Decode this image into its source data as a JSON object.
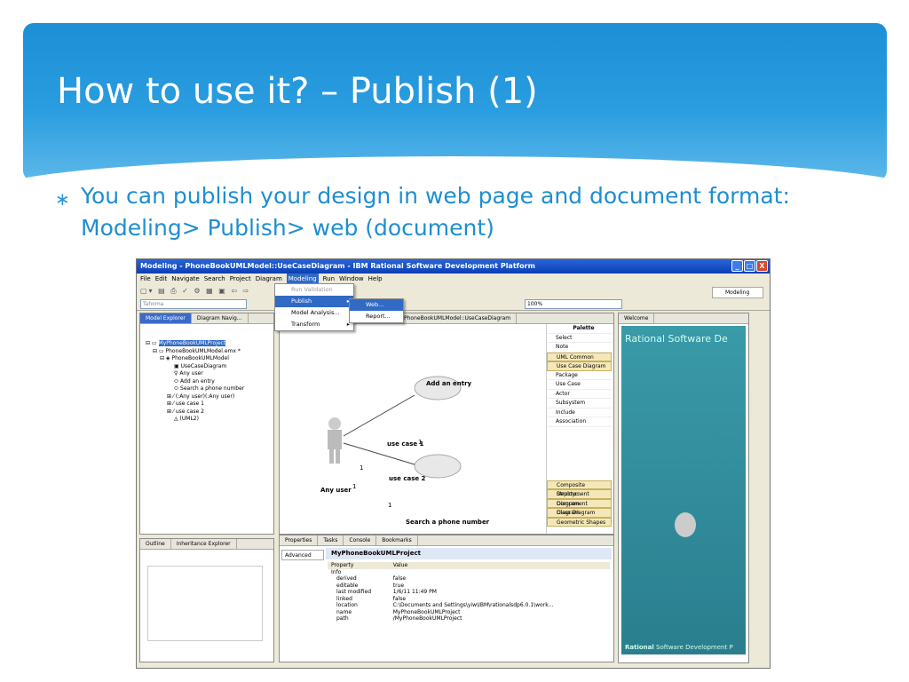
{
  "slide": {
    "title": "How to use it? – Publish (1)",
    "bullet": "You can publish your design in web page and document format: Modeling> Publish> web (document)",
    "bullet_marker": "∗"
  },
  "window": {
    "title": "Modeling - PhoneBookUMLModel::UseCaseDiagram - IBM Rational Software Development Platform",
    "buttons": [
      "_",
      "□",
      "X"
    ]
  },
  "menubar": [
    "File",
    "Edit",
    "Navigate",
    "Search",
    "Project",
    "Diagram",
    "Modeling",
    "Run",
    "Window",
    "Help"
  ],
  "toolbar": {
    "font": "Tahoma",
    "zoom": "100%",
    "perspective": "Modeling"
  },
  "modeling_menu": [
    {
      "label": "Run Validation",
      "disabled": true
    },
    {
      "label": "Publish",
      "submenu": true,
      "highlight": true
    },
    {
      "label": "Model Analysis..."
    },
    {
      "label": "Transform",
      "submenu": true
    }
  ],
  "publish_submenu": [
    "Web...",
    "Report..."
  ],
  "model_explorer": {
    "tabs": [
      "Model Explorer",
      "Diagram Navig..."
    ],
    "tree": [
      "MyPhoneBookUMLProject",
      "PhoneBookUMLModel.emx *",
      "PhoneBookUMLModel",
      "UseCaseDiagram",
      "Any user",
      "Add an entry",
      "Search a phone number",
      "(:Any user)(:Any user)",
      "use case 1",
      "use case 2",
      "(UML2)"
    ]
  },
  "editor": {
    "tab": "PhoneBookUMLModel::UseCaseDiagram",
    "actor": "Any user",
    "uc1": "Add an entry",
    "uc2": "Search a phone number",
    "assoc1": "use case 1",
    "assoc2": "use case 2",
    "m1": "1",
    "m2": "1",
    "m3": "1",
    "m4": "1"
  },
  "palette": {
    "title": "Palette",
    "tools": [
      "Select",
      "Note"
    ],
    "drawers": [
      "UML Common",
      "Use Case Diagram"
    ],
    "items": [
      "Package",
      "Use Case",
      "Actor",
      "Subsystem",
      "Include",
      "Association"
    ],
    "bottom_drawers": [
      "Composite Structu...",
      "Deployment Diagram",
      "Component Diagram",
      "Class Diagram",
      "Geometric Shapes"
    ]
  },
  "welcome": {
    "tab": "Welcome",
    "heading": "Rational Software De",
    "footer_bold": "Rational",
    "footer": "Software Development P"
  },
  "outline": {
    "tabs": [
      "Outline",
      "Inheritance Explorer"
    ]
  },
  "properties": {
    "tabs": [
      "Properties",
      "Tasks",
      "Console",
      "Bookmarks"
    ],
    "sidebar": "Advanced",
    "header": "MyPhoneBookUMLProject",
    "columns": [
      "Property",
      "Value"
    ],
    "group": "Info",
    "rows": [
      [
        "derived",
        "false"
      ],
      [
        "editable",
        "true"
      ],
      [
        "last modified",
        "1/6/11 11:49 PM"
      ],
      [
        "linked",
        "false"
      ],
      [
        "location",
        "C:\\Documents and Settings\\yiw\\IBM\\rationalsdp6.0.1\\work..."
      ],
      [
        "name",
        "MyPhoneBookUMLProject"
      ],
      [
        "path",
        "/MyPhoneBookUMLProject"
      ]
    ]
  }
}
